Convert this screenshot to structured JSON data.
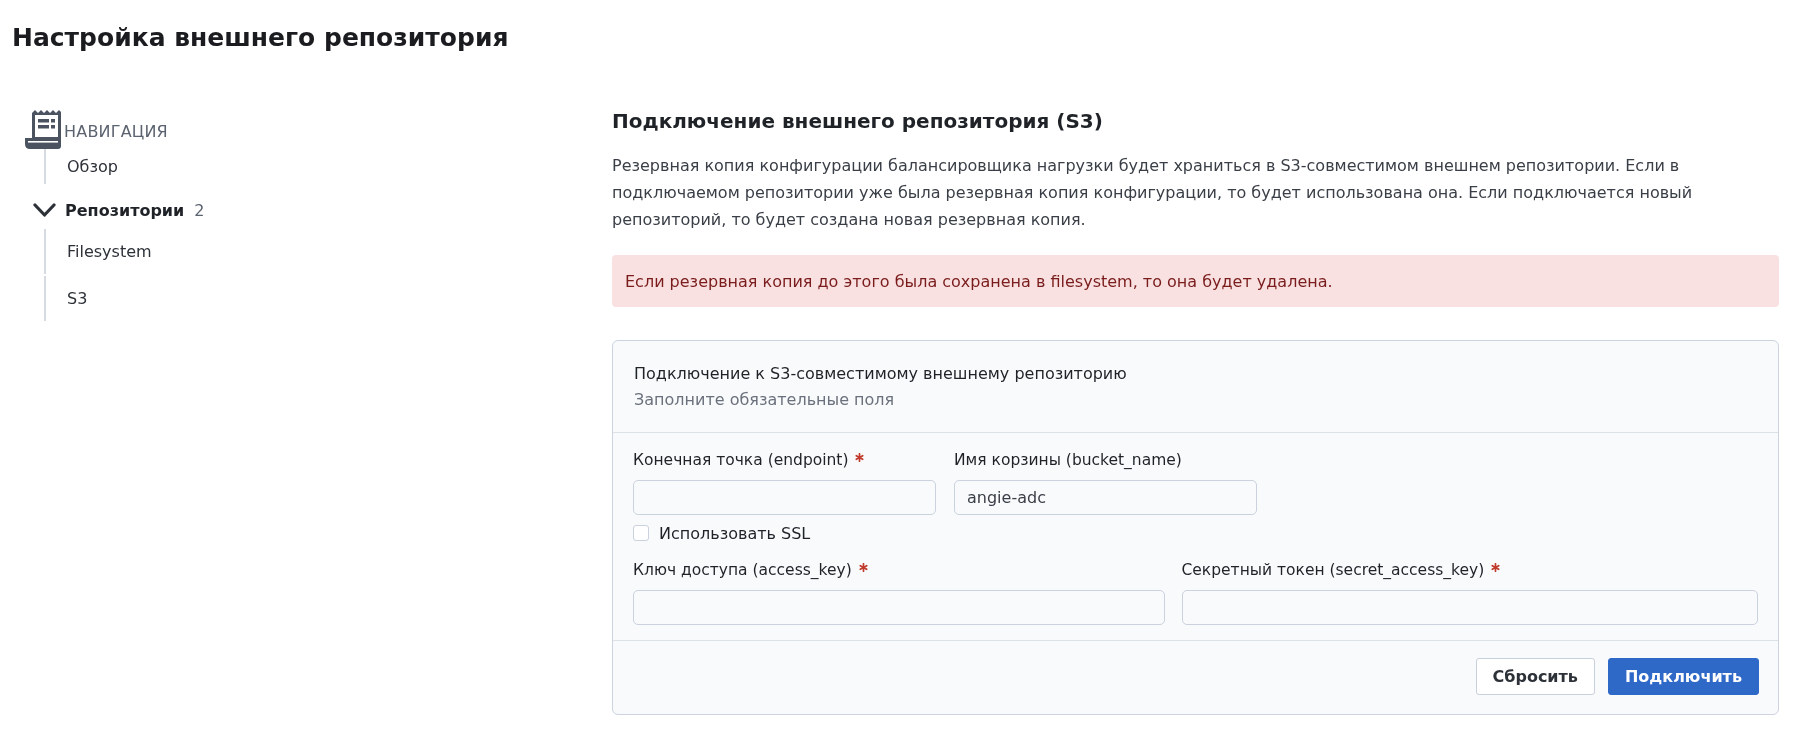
{
  "page": {
    "title": "Настройка внешнего репозитория"
  },
  "navigation": {
    "heading": "НАВИГАЦИЯ",
    "items": [
      {
        "kind": "link",
        "label": "Обзор"
      },
      {
        "kind": "group",
        "label": "Репозитории",
        "count": "2",
        "expanded": true,
        "children": [
          {
            "kind": "link",
            "label": "Filesystem"
          },
          {
            "kind": "link",
            "label": "S3"
          }
        ]
      }
    ]
  },
  "section": {
    "heading": "Подключение внешнего репозитория (S3)",
    "description": "Резервная копия конфигурации балансировщика нагрузки будет храниться в S3-совместимом внешнем репозитории. Если в подключаемом репозитории уже была резервная копия конфигурации, то будет использована она. Если подключается новый репозиторий, то будет создана новая резервная копия.",
    "alert": {
      "kind": "danger",
      "text": "Если резервная копия до этого была сохранена в filesystem, то она будет удалена."
    }
  },
  "form": {
    "title": "Подключение к S3-совместимому внешнему репозиторию",
    "subtitle": "Заполните обязательные поля",
    "rows": [
      {
        "kind": "fields",
        "fields": [
          {
            "label": "Конечная точка (endpoint)",
            "required": true
          },
          {
            "label": "Имя корзины (bucket_name)",
            "required": false,
            "value": "angie-adc"
          }
        ]
      },
      {
        "kind": "checkbox",
        "label": "Использовать SSL",
        "checked": false
      },
      {
        "kind": "fields",
        "fields": [
          {
            "label": "Ключ доступа (access_key)",
            "required": true
          },
          {
            "label": "Секретный токен (secret_access_key)",
            "required": true
          }
        ]
      }
    ],
    "buttons": [
      {
        "kind": "secondary",
        "label": "Сбросить"
      },
      {
        "kind": "primary",
        "label": "Подключить"
      }
    ]
  }
}
